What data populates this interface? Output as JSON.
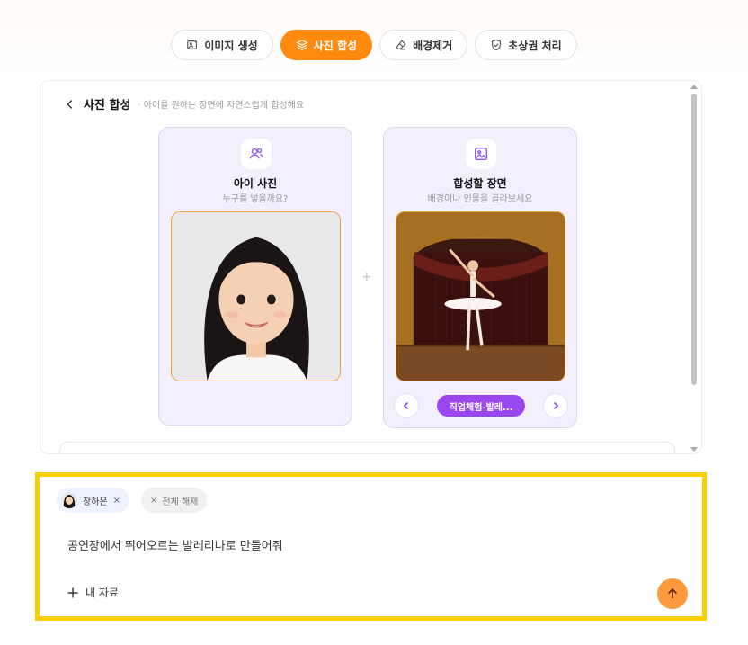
{
  "tabs": [
    {
      "label": "이미지 생성",
      "icon": "image-edit-icon",
      "active": false
    },
    {
      "label": "사진 합성",
      "icon": "layers-icon",
      "active": true
    },
    {
      "label": "배경제거",
      "icon": "eraser-icon",
      "active": false
    },
    {
      "label": "초상권 처리",
      "icon": "shield-icon",
      "active": false
    }
  ],
  "panel": {
    "title": "사진 합성",
    "subtitle": "· 아이를 원하는 장면에 자연스럽게 합성해요"
  },
  "child_card": {
    "title": "아이 사진",
    "subtitle": "누구를 넣을까요?",
    "icon": "users-icon"
  },
  "scene_card": {
    "title": "합성할 장면",
    "subtitle": "배경이나 인물을 골라보세요",
    "icon": "image-icon",
    "selected_scene": "직업체험-발레..."
  },
  "separator": "+",
  "composer": {
    "user_chip": "장하은",
    "chip_remove": "×",
    "clear_all": "전체 해제",
    "prompt": "공연장에서 뛰어오르는 발레리나로 만들어줘",
    "my_data": "내 자료"
  },
  "colors": {
    "accent": "#ff8a0d",
    "scene_chip": "#9a47f0",
    "highlight_border": "#f7d000",
    "send_button": "#ff9a3c"
  }
}
